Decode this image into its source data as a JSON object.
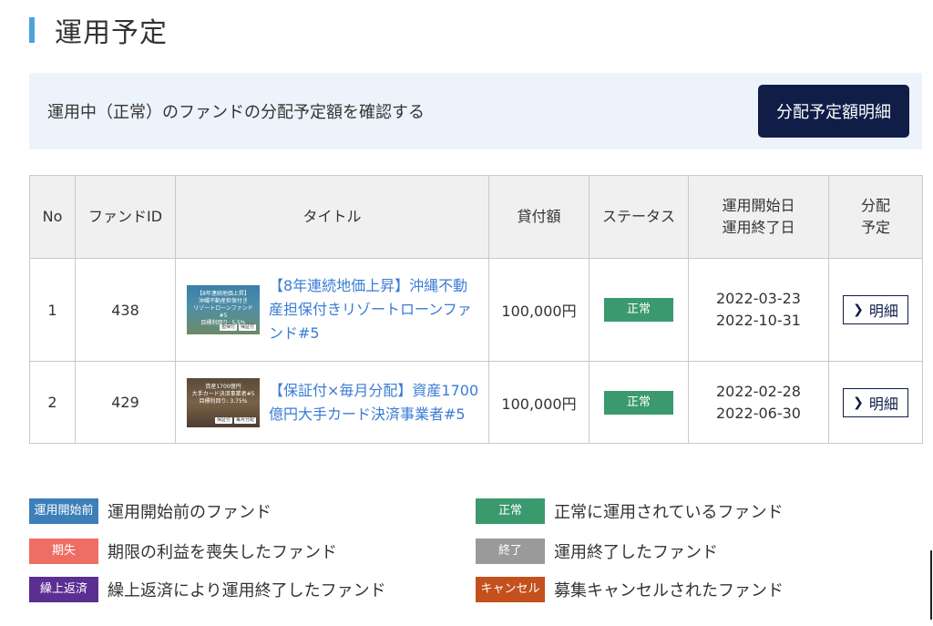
{
  "heading": "運用予定",
  "banner": {
    "text": "運用中（正常）のファンドの分配予定額を確認する",
    "button_label": "分配予定額明細"
  },
  "table": {
    "headers": {
      "no": "No",
      "fund_id": "ファンドID",
      "title": "タイトル",
      "amount": "貸付額",
      "status": "ステータス",
      "start_label": "運用開始日",
      "end_label": "運用終了日",
      "dist_line1": "分配",
      "dist_line2": "予定"
    },
    "rows": [
      {
        "no": "1",
        "fund_id": "438",
        "title": "【8年連続地価上昇】沖縄不動産担保付きリゾートローンファンド#5",
        "thumb_lines": [
          "【8年連続地価上昇】",
          "沖縄不動産担保付き",
          "リゾートローンファンド#5",
          "目標利回り: 5.5%"
        ],
        "thumb_badges": [
          "担保付",
          "保証付"
        ],
        "amount": "100,000円",
        "status": "正常",
        "start": "2022-03-23",
        "end": "2022-10-31",
        "detail_label": "明細"
      },
      {
        "no": "2",
        "fund_id": "429",
        "title": "【保証付×毎月分配】資産1700億円大手カード決済事業者#5",
        "thumb_lines": [
          "資産1700億円",
          "大手カード決済事業者#5",
          "目標利回り: 3.75%"
        ],
        "thumb_badges": [
          "保証付",
          "毎月分配"
        ],
        "amount": "100,000円",
        "status": "正常",
        "start": "2022-02-28",
        "end": "2022-06-30",
        "detail_label": "明細"
      }
    ]
  },
  "legend": [
    {
      "badge": "運用開始前",
      "text": "運用開始前のファンド",
      "color": "#3d7fb8"
    },
    {
      "badge": "正常",
      "text": "正常に運用されているファンド",
      "color": "#3a9a6e"
    },
    {
      "badge": "期失",
      "text": "期限の利益を喪失したファンド",
      "color": "#ee6e63"
    },
    {
      "badge": "終了",
      "text": "運用終了したファンド",
      "color": "#9a9a9a"
    },
    {
      "badge": "繰上返済",
      "text": "繰上返済により運用終了したファンド",
      "color": "#5b2e91"
    },
    {
      "badge": "キャンセル",
      "text": "募集キャンセルされたファンド",
      "color": "#c4511d"
    }
  ],
  "colors": {
    "accent": "#4da3d9",
    "navy": "#0f1d47",
    "link": "#3a7bd5",
    "status_normal": "#3a9a6e"
  }
}
